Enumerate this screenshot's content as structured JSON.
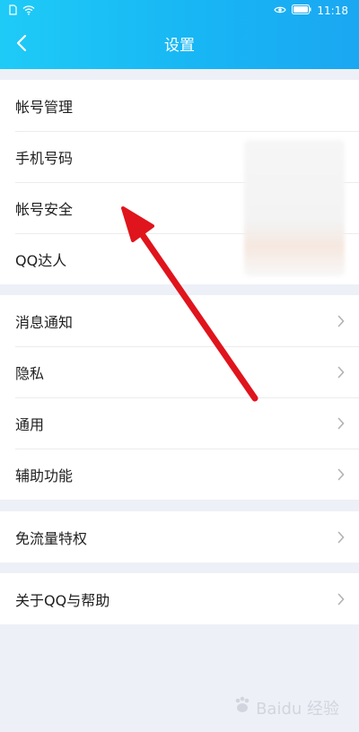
{
  "status_bar": {
    "time": "11:18",
    "icons": [
      "sim-icon",
      "wifi-icon",
      "eye-icon",
      "battery-icon"
    ]
  },
  "header": {
    "title": "设置",
    "back_icon": "chevron-left-icon"
  },
  "groups": [
    {
      "items": [
        {
          "label": "帐号管理",
          "chevron": false
        },
        {
          "label": "手机号码",
          "chevron": false
        },
        {
          "label": "帐号安全",
          "chevron": false
        },
        {
          "label": "QQ达人",
          "chevron": false
        }
      ]
    },
    {
      "items": [
        {
          "label": "消息通知",
          "chevron": true
        },
        {
          "label": "隐私",
          "chevron": true
        },
        {
          "label": "通用",
          "chevron": true
        },
        {
          "label": "辅助功能",
          "chevron": true
        }
      ]
    },
    {
      "items": [
        {
          "label": "免流量特权",
          "chevron": true
        }
      ]
    },
    {
      "items": [
        {
          "label": "关于QQ与帮助",
          "chevron": true
        }
      ]
    }
  ],
  "overlay": {
    "arrow_color": "#e0141c",
    "watermark": "Baidu 经验",
    "watermark_logo": "paw-icon"
  },
  "colors": {
    "header_start": "#1ecbf7",
    "header_end": "#1aa7f2",
    "page_background": "#eef0f7"
  }
}
